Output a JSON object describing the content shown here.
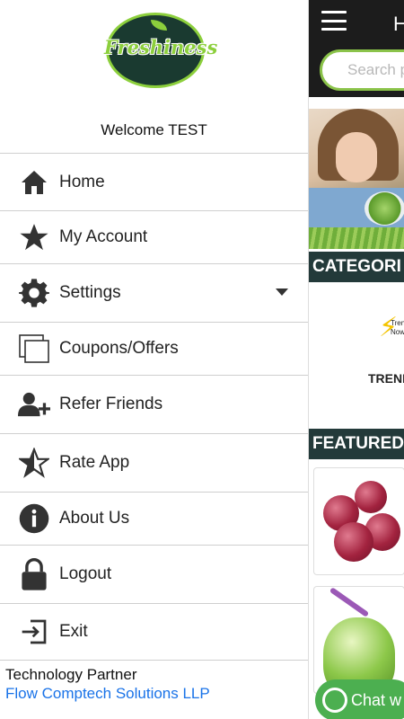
{
  "app": {
    "title": "H",
    "search_placeholder": "Search p",
    "categories_heading": "CATEGORI",
    "trending_label": "TREND",
    "trending_icon_text": "Tren Now",
    "featured_heading": "FEATURED P",
    "chat_label": "Chat w"
  },
  "drawer": {
    "logo_text": "Freshiness",
    "welcome": "Welcome TEST",
    "items": [
      {
        "label": "Home",
        "icon": "home-icon"
      },
      {
        "label": "My Account",
        "icon": "star-icon"
      },
      {
        "label": "Settings",
        "icon": "gear-icon"
      },
      {
        "label": "Coupons/Offers",
        "icon": "copy-icon"
      },
      {
        "label": "Refer Friends",
        "icon": "add-user-icon"
      },
      {
        "label": "Rate App",
        "icon": "star-outline-icon"
      },
      {
        "label": "About Us",
        "icon": "info-icon"
      },
      {
        "label": "Logout",
        "icon": "lock-icon"
      },
      {
        "label": "Exit",
        "icon": "exit-icon"
      }
    ],
    "partner_label": "Technology Partner",
    "partner_name": "Flow Comptech Solutions LLP"
  },
  "colors": {
    "accent_green": "#8ccf3c",
    "header_dark": "#1c1c1c",
    "section_bar": "#233a3a",
    "link_blue": "#1a73e8",
    "whatsapp_green": "#4caf50"
  }
}
